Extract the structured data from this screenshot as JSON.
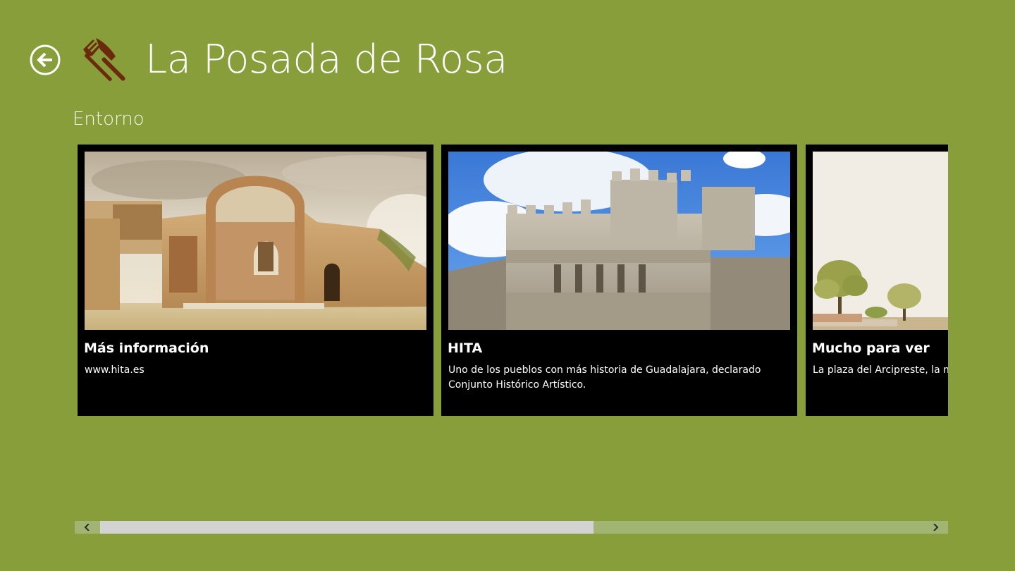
{
  "header": {
    "title": "La Posada de Rosa",
    "back_icon": "back-arrow-icon",
    "logo_icon": "fork-knife-icon"
  },
  "section": {
    "title": "Entorno"
  },
  "cards": [
    {
      "title": "Más información",
      "description": "www.hita.es",
      "image": "arch-ruins-image"
    },
    {
      "title": "HITA",
      "description": "Uno de los pueblos con más historia de Guadalajara, declarado Conjunto Histórico Artístico.",
      "image": "castle-gate-image"
    },
    {
      "title": "Mucho para ver",
      "description": "La plaza del Arcipreste, la mu",
      "image": "trees-landscape-image"
    }
  ],
  "scrollbar": {
    "position": 0.0,
    "visible_fraction": 0.6,
    "left_icon": "chevron-left-icon",
    "right_icon": "chevron-right-icon"
  },
  "colors": {
    "background": "#879e3b",
    "card": "#000000",
    "logo": "#6b2a0c",
    "scroll_track": "#a2b472",
    "scroll_thumb": "#d3d3d3"
  }
}
